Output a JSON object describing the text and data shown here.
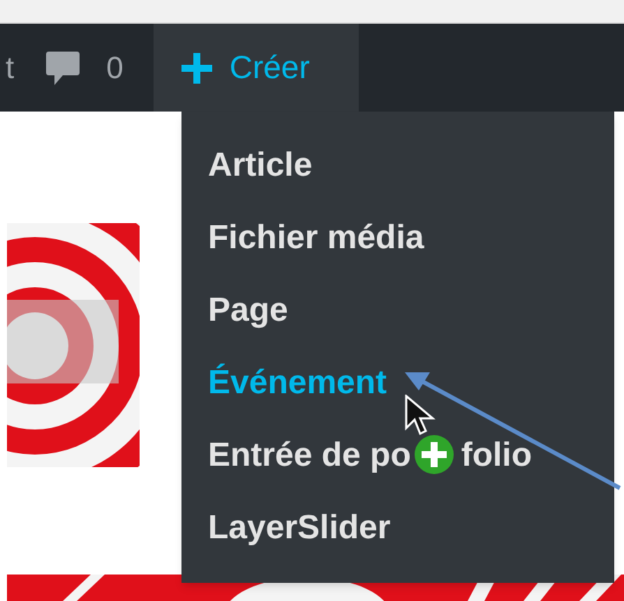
{
  "admin_bar": {
    "items": [
      {
        "kind": "text",
        "label": "t",
        "selected": false
      },
      {
        "kind": "comments",
        "label": "0",
        "selected": false
      },
      {
        "kind": "new",
        "label": "Créer",
        "selected": true
      }
    ]
  },
  "dropdown": {
    "items": [
      {
        "label": "Article",
        "selected": false
      },
      {
        "label": "Fichier média",
        "selected": false
      },
      {
        "label": "Page",
        "selected": false
      },
      {
        "label": "Événement",
        "selected": true
      },
      {
        "label": "Entrée de po",
        "label_after_cursor": "folio",
        "selected": false
      },
      {
        "label": "LayerSlider",
        "selected": false
      }
    ]
  }
}
